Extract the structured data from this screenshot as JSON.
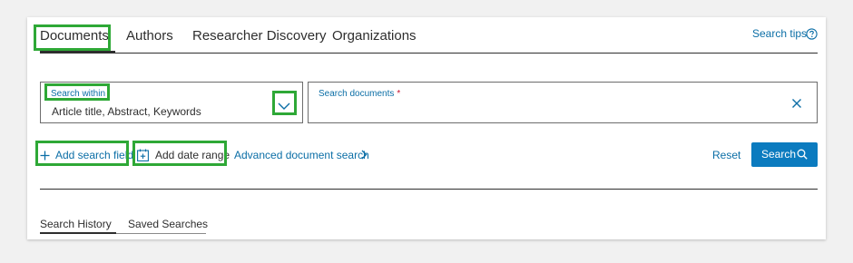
{
  "tabs": [
    {
      "label": "Documents",
      "active": true
    },
    {
      "label": "Authors",
      "active": false
    },
    {
      "label": "Researcher Discovery",
      "active": false
    },
    {
      "label": "Organizations",
      "active": false
    }
  ],
  "header": {
    "search_tips": "Search tips",
    "help_icon": "question-circle-icon"
  },
  "search_within": {
    "label": "Search within",
    "value": "Article title, Abstract, Keywords",
    "dropdown_icon": "chevron-down-icon"
  },
  "search_documents": {
    "label": "Search documents",
    "required_mark": "*",
    "clear_icon": "close-icon"
  },
  "actions": {
    "add_search_field": "Add search field",
    "add_date_range": "Add date range",
    "advanced_search": "Advanced document search",
    "reset": "Reset",
    "search": "Search"
  },
  "history_tabs": [
    {
      "label": "Search History",
      "active": true
    },
    {
      "label": "Saved Searches",
      "active": false
    }
  ],
  "colors": {
    "link": "#0b6ea6",
    "primary_button": "#0b7bbf",
    "highlight": "#2ea836",
    "required": "#c8102e",
    "text": "#2e2e2e"
  }
}
